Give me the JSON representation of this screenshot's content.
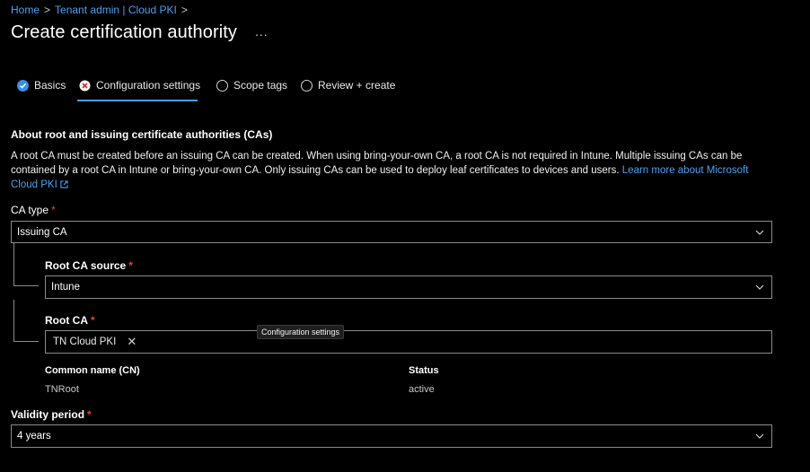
{
  "breadcrumb": {
    "items": [
      "Home",
      "Tenant admin | Cloud PKI"
    ],
    "separator": ">"
  },
  "page": {
    "title": "Create certification authority",
    "more_label": "..."
  },
  "tabs": [
    {
      "label": "Basics",
      "state": "complete"
    },
    {
      "label": "Configuration settings",
      "state": "error",
      "active": true
    },
    {
      "label": "Scope tags",
      "state": "pending"
    },
    {
      "label": "Review + create",
      "state": "pending"
    }
  ],
  "section": {
    "heading": "About root and issuing certificate authorities (CAs)",
    "description": "A root CA must be created before an issuing CA can be created. When using bring-your-own CA, a root CA is not required in Intune. Multiple issuing CAs can be contained by a root CA in Intune or bring-your-own CA. Only issuing CAs can be used to deploy leaf certificates to devices and users. ",
    "link": "Learn more about Microsoft Cloud PKI"
  },
  "ca_type": {
    "label": "CA type",
    "required": "*",
    "value": "Issuing CA"
  },
  "root_ca_source": {
    "label": "Root CA source",
    "required": "*",
    "value": "Intune"
  },
  "root_ca": {
    "label": "Root CA",
    "required": "*",
    "tag": "TN Cloud PKI",
    "remove": "✕"
  },
  "tooltip": "Configuration settings",
  "details": {
    "cn_label": "Common name (CN)",
    "cn_value": "TNRoot",
    "status_label": "Status",
    "status_value": "active"
  },
  "validity": {
    "label": "Validity period",
    "required": "*",
    "value": "4 years"
  },
  "colors": {
    "accent": "#4aa0f0",
    "error": "#e0453a",
    "background": "#000000"
  }
}
